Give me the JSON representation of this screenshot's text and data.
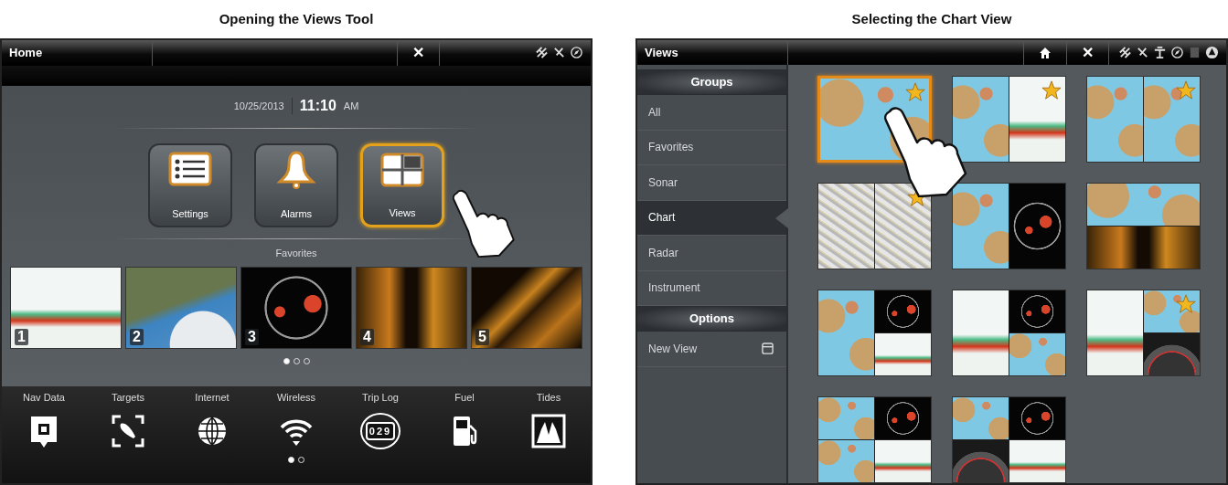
{
  "figures": [
    {
      "title": "Opening the Views Tool",
      "screen": {
        "title": "Home",
        "close": "✕",
        "date": "10/25/2013",
        "time": "11:10",
        "ampm": "AM",
        "tools": [
          {
            "label": "Settings",
            "selected": false
          },
          {
            "label": "Alarms",
            "selected": false
          },
          {
            "label": "Views",
            "selected": true
          }
        ],
        "favorites_label": "Favorites",
        "favorites": [
          {
            "label": "1",
            "kind": "sonar"
          },
          {
            "label": "2",
            "kind": "satellite"
          },
          {
            "label": "3",
            "kind": "radar"
          },
          {
            "label": "4",
            "kind": "sidescan"
          },
          {
            "label": "5",
            "kind": "downscan"
          }
        ],
        "favorites_pages": [
          {
            "selected": true
          },
          {
            "selected": false
          },
          {
            "selected": false
          }
        ],
        "shortcuts": [
          {
            "label": "Nav Data"
          },
          {
            "label": "Targets"
          },
          {
            "label": "Internet"
          },
          {
            "label": "Wireless"
          },
          {
            "label": "Trip Log",
            "counter": "029"
          },
          {
            "label": "Fuel"
          },
          {
            "label": "Tides"
          }
        ],
        "shortcut_pages": [
          {
            "selected": true
          },
          {
            "selected": false
          }
        ]
      }
    },
    {
      "title": "Selecting the Chart View",
      "screen": {
        "title": "Views",
        "close": "✕",
        "sections": [
          {
            "title": "Groups",
            "kind": "groups",
            "items": [
              {
                "label": "All",
                "selected": false
              },
              {
                "label": "Favorites",
                "selected": false
              },
              {
                "label": "Sonar",
                "selected": false
              },
              {
                "label": "Chart",
                "selected": true
              },
              {
                "label": "Radar",
                "selected": false
              },
              {
                "label": "Instrument",
                "selected": false
              }
            ]
          },
          {
            "title": "Options",
            "kind": "options",
            "items": [
              {
                "label": "New View"
              }
            ]
          }
        ],
        "tiles": [
          {
            "kind": "single",
            "panes": [
              {
                "kind": "chart"
              }
            ],
            "favorite": true,
            "selected": true
          },
          {
            "kind": "columns",
            "panes": [
              {
                "kind": "chart"
              },
              {
                "kind": "sonar"
              }
            ],
            "favorite": true,
            "selected": false
          },
          {
            "kind": "columns",
            "panes": [
              {
                "kind": "chart"
              },
              {
                "kind": "chart"
              }
            ],
            "favorite": true,
            "selected": false
          },
          {
            "kind": "columns",
            "panes": [
              {
                "kind": "terrain"
              },
              {
                "kind": "terrain"
              }
            ],
            "favorite": true,
            "selected": false
          },
          {
            "kind": "columns",
            "panes": [
              {
                "kind": "chart"
              },
              {
                "kind": "radar"
              }
            ],
            "favorite": false,
            "selected": false
          },
          {
            "kind": "rows",
            "panes": [
              {
                "kind": "chart"
              },
              {
                "kind": "sidescan"
              }
            ],
            "favorite": false,
            "selected": false
          },
          {
            "kind": "left-full",
            "panes": [
              {
                "kind": "chart"
              },
              {
                "kind": "radar"
              },
              {
                "kind": "sonar"
              }
            ],
            "favorite": false,
            "selected": false
          },
          {
            "kind": "left-full",
            "panes": [
              {
                "kind": "sonar"
              },
              {
                "kind": "radar"
              },
              {
                "kind": "chart"
              }
            ],
            "favorite": false,
            "selected": false
          },
          {
            "kind": "left-full",
            "panes": [
              {
                "kind": "sonar"
              },
              {
                "kind": "chart"
              },
              {
                "kind": "gauge"
              }
            ],
            "favorite": true,
            "selected": false
          },
          {
            "kind": "quad",
            "panes": [
              {
                "kind": "chart"
              },
              {
                "kind": "radar"
              },
              {
                "kind": "chart"
              },
              {
                "kind": "sonar"
              }
            ],
            "favorite": false,
            "selected": false
          },
          {
            "kind": "quad",
            "panes": [
              {
                "kind": "chart"
              },
              {
                "kind": "radar"
              },
              {
                "kind": "gauge"
              },
              {
                "kind": "sonar"
              }
            ],
            "favorite": false,
            "selected": false
          }
        ]
      }
    }
  ]
}
